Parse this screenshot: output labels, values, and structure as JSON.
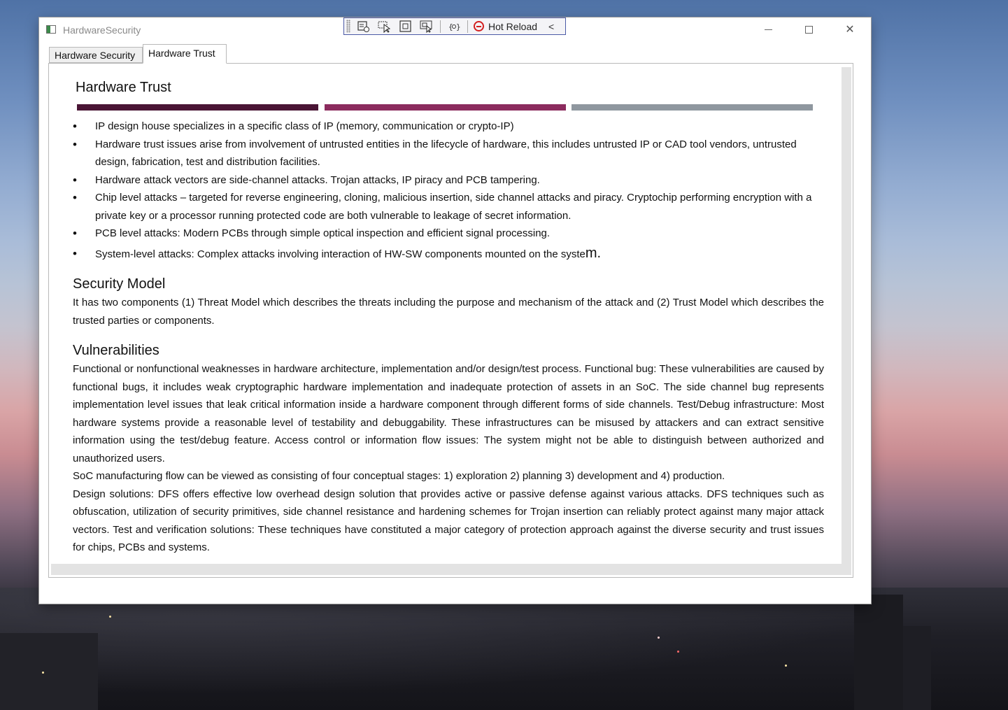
{
  "window": {
    "title": "HardwareSecurity",
    "min_glyph": "",
    "close_glyph": "✕"
  },
  "hot_reload": {
    "label": "Hot Reload",
    "collapse_glyph": "<"
  },
  "tabs": [
    {
      "label": "Hardware Security",
      "selected": false
    },
    {
      "label": "Hardware Trust",
      "selected": true
    }
  ],
  "document": {
    "title": "Hardware Trust",
    "bar_colors": [
      "#4a1535",
      "#8c2c5e",
      "#8f979f"
    ],
    "bullets": [
      "IP design house specializes in a specific class of IP (memory, communication or crypto-IP)",
      "Hardware trust issues arise from involvement of untrusted entities in the lifecycle of hardware, this includes untrusted IP or CAD tool vendors, untrusted design, fabrication, test and distribution facilities.",
      "Hardware attack vectors are side-channel attacks. Trojan attacks, IP piracy and PCB tampering.",
      "Chip level attacks – targeted for reverse engineering, cloning, malicious insertion, side channel attacks and piracy. Cryptochip performing encryption with a private key or a processor running protected code are both vulnerable to leakage of secret information.",
      "PCB level attacks: Modern PCBs through simple optical inspection and efficient signal processing."
    ],
    "last_bullet_prefix": "System-level attacks: Complex attacks involving interaction of HW-SW components mounted on the syste",
    "last_bullet_suffix": "m.",
    "security_heading": "Security Model",
    "security_text": "It has two components (1) Threat Model which describes the threats including the purpose and mechanism of the attack and (2) Trust Model which describes the trusted parties or components.",
    "vuln_heading": "Vulnerabilities",
    "vuln_p1": "Functional or nonfunctional weaknesses in hardware architecture, implementation and/or design/test process. Functional bug: These vulnerabilities are caused by functional bugs, it includes weak cryptographic hardware implementation and inadequate protection of assets in an SoC.  The side channel bug represents implementation level issues that leak critical information inside a hardware component through different forms of side channels.  Test/Debug infrastructure: Most hardware systems provide a reasonable level of testability and debuggability. These infrastructures can be misused by attackers and can extract sensitive information using the test/debug feature. Access control or information flow issues: The system might not be able to distinguish between authorized and unauthorized users.",
    "vuln_p2": "SoC manufacturing flow can be viewed as consisting of four conceptual stages:  1) exploration   2) planning  3) development and  4) production.",
    "vuln_p3": "Design solutions: DFS offers effective low overhead design solution that provides active or passive defense against various attacks.  DFS techniques such as obfuscation, utilization of security primitives, side channel resistance and hardening schemes for Trojan insertion can reliably protect against many major attack vectors. Test and verification solutions: These techniques have constituted a major category of protection approach against the diverse security and trust issues for chips, PCBs and systems."
  }
}
